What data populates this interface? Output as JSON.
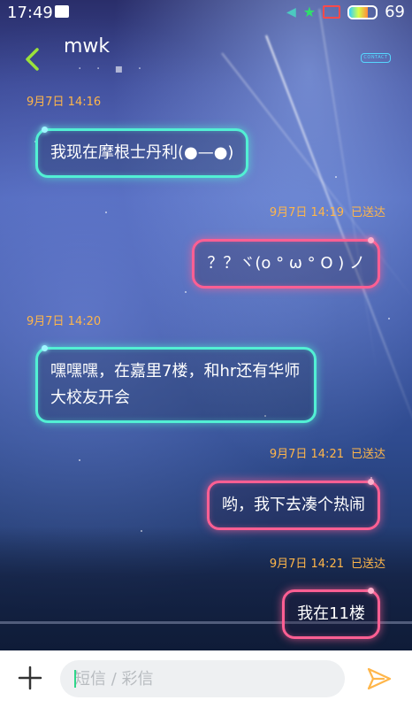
{
  "status_bar": {
    "time": "17:49",
    "battery_percent": "69",
    "battery_level": 0.69
  },
  "header": {
    "contact_name": "mwk",
    "contact_number": "· · ▪ ·",
    "contact_button_label": "CONTACT"
  },
  "messages": [
    {
      "timestamp": "9月7日 14:16",
      "direction": "incoming",
      "text": "我现在摩根士丹利(●—●)"
    },
    {
      "timestamp": "9月7日 14:19",
      "status": "已送达",
      "direction": "outgoing",
      "text": "？？ヾ(o ° ω ° O ) ノ"
    },
    {
      "timestamp": "9月7日 14:20",
      "direction": "incoming",
      "text": "嘿嘿嘿，在嘉里7楼，和hr还有华师大校友开会"
    },
    {
      "timestamp": "9月7日 14:21",
      "status": "已送达",
      "direction": "outgoing",
      "text": "哟，我下去凑个热闹"
    },
    {
      "timestamp": "9月7日 14:21",
      "status": "已送达",
      "direction": "outgoing",
      "text": "我在11楼"
    }
  ],
  "input_bar": {
    "placeholder": "短信 / 彩信"
  },
  "colors": {
    "incoming_border": "#52f0d4",
    "outgoing_border": "#ff5f93",
    "timestamp": "#ffb64a",
    "accent_back": "#9be23a",
    "send_icon": "#ffb64a"
  },
  "icons": {
    "back": "chevron-left-icon",
    "add": "plus-icon",
    "send": "send-icon",
    "status_notification": "notification-icon",
    "status_mute": "mute-icon",
    "status_wifi": "wifi-icon",
    "status_screen": "screen-cast-icon",
    "status_battery": "battery-icon"
  }
}
